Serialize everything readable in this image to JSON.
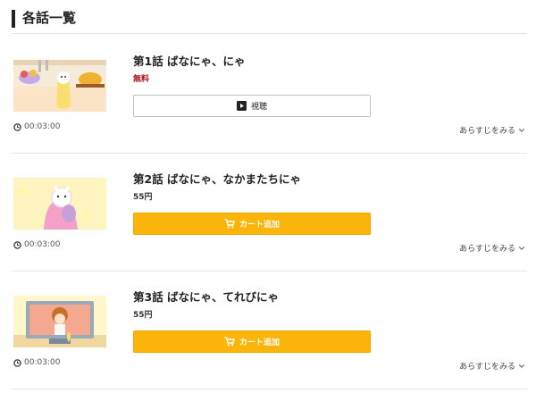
{
  "section": {
    "title": "各話一覧"
  },
  "episodes": [
    {
      "title": "第1話 ばなにゃ、にゃ",
      "price": "無料",
      "button": {
        "label": "視聴",
        "icon": "play-icon"
      },
      "duration": "00:03:00",
      "synopsis": "あらすじをみる"
    },
    {
      "title": "第2話 ばなにゃ、なかまたちにゃ",
      "price": "55円",
      "button": {
        "label": "カート追加",
        "icon": "cart-icon"
      },
      "duration": "00:03:00",
      "synopsis": "あらすじをみる"
    },
    {
      "title": "第3話 ばなにゃ、てれびにゃ",
      "price": "55円",
      "button": {
        "label": "カート追加",
        "icon": "cart-icon"
      },
      "duration": "00:03:00",
      "synopsis": "あらすじをみる"
    }
  ],
  "colors": {
    "cart_button": "#fbb40a",
    "free_price": "#b1121b"
  }
}
